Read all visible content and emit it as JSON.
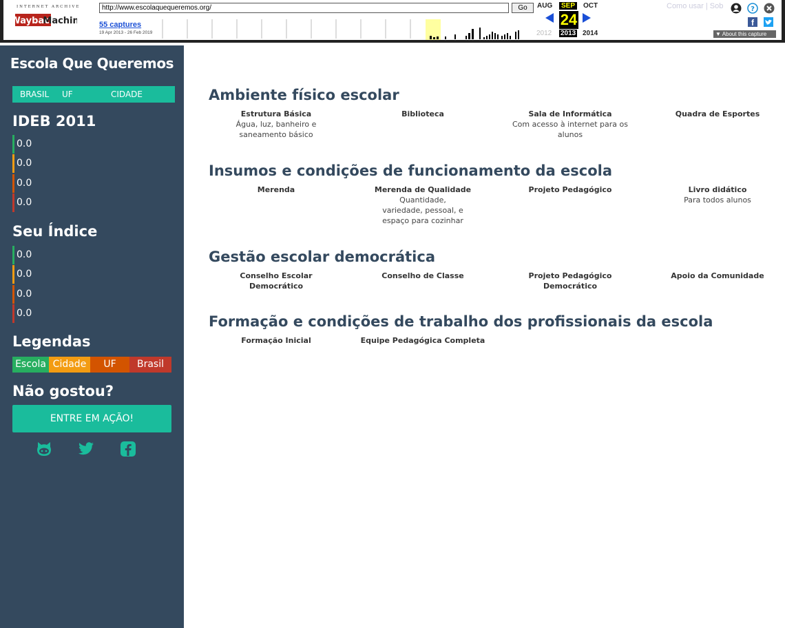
{
  "wayback": {
    "ia_label": "INTERNET ARCHIVE",
    "logo_text": "WaybackMachine",
    "url": "http://www.escolaquequeremos.org/",
    "go_label": "Go",
    "captures": "55 captures",
    "capture_range": "19 Apr 2013 - 26 Feb 2019",
    "months": [
      "AUG",
      "SEP",
      "OCT"
    ],
    "day": "24",
    "years": [
      "2012",
      "2013",
      "2014"
    ],
    "howto": "Como usar | Sob",
    "about": "▼ About this capture",
    "fb_glyph": "f",
    "colors": {
      "link": "#1a4fd6",
      "highlight": "#ffff00",
      "sparkline_bg": "#ffffa0"
    }
  },
  "sidebar": {
    "title": "Escola Que Queremos",
    "scope_tabs": [
      "BRASIL",
      "UF",
      "CIDADE"
    ],
    "ideb_heading": "IDEB 2011",
    "ideb_scores": [
      "0.0",
      "0.0",
      "0.0",
      "0.0"
    ],
    "index_heading": "Seu Índice",
    "index_scores": [
      "0.0",
      "0.0",
      "0.0",
      "0.0"
    ],
    "legend_heading": "Legendas",
    "legend": [
      {
        "label": "Escola",
        "color": "#27ae60"
      },
      {
        "label": "Cidade",
        "color": "#f39c12"
      },
      {
        "label": "UF",
        "color": "#d35400"
      },
      {
        "label": "Brasil",
        "color": "#c0392b"
      }
    ],
    "cta_heading": "Não gostou?",
    "cta_label": "ENTRE EM AÇÃO!",
    "social_icons": [
      "github-icon",
      "twitter-icon",
      "facebook-icon"
    ],
    "colors": {
      "bg": "#34495e",
      "accent": "#1abc9c"
    }
  },
  "categories": [
    {
      "title": "Ambiente físico escolar",
      "items": [
        {
          "name": "Estrutura Básica",
          "desc": "Água, luz, banheiro e saneamento básico"
        },
        {
          "name": "Biblioteca",
          "desc": ""
        },
        {
          "name": "Sala de Informática",
          "desc": "Com acesso à internet para os alunos"
        },
        {
          "name": "Quadra de Esportes",
          "desc": ""
        }
      ]
    },
    {
      "title": "Insumos e condições de funcionamento da escola",
      "items": [
        {
          "name": "Merenda",
          "desc": ""
        },
        {
          "name": "Merenda de Qualidade",
          "desc": "Quantidade, variedade, pessoal, e espaço para cozinhar"
        },
        {
          "name": "Projeto Pedagógico",
          "desc": ""
        },
        {
          "name": "Livro didático",
          "desc": "Para todos alunos"
        }
      ]
    },
    {
      "title": "Gestão escolar democrática",
      "items": [
        {
          "name": "Conselho Escolar Democrático",
          "desc": ""
        },
        {
          "name": "Conselho de Classe",
          "desc": ""
        },
        {
          "name": "Projeto Pedagógico Democrático",
          "desc": ""
        },
        {
          "name": "Apoio da Comunidade",
          "desc": ""
        }
      ]
    },
    {
      "title": "Formação e condições de trabalho dos profissionais da escola",
      "items": [
        {
          "name": "Formação Inicial",
          "desc": ""
        },
        {
          "name": "Equipe Pedagógica Completa",
          "desc": ""
        }
      ]
    }
  ]
}
